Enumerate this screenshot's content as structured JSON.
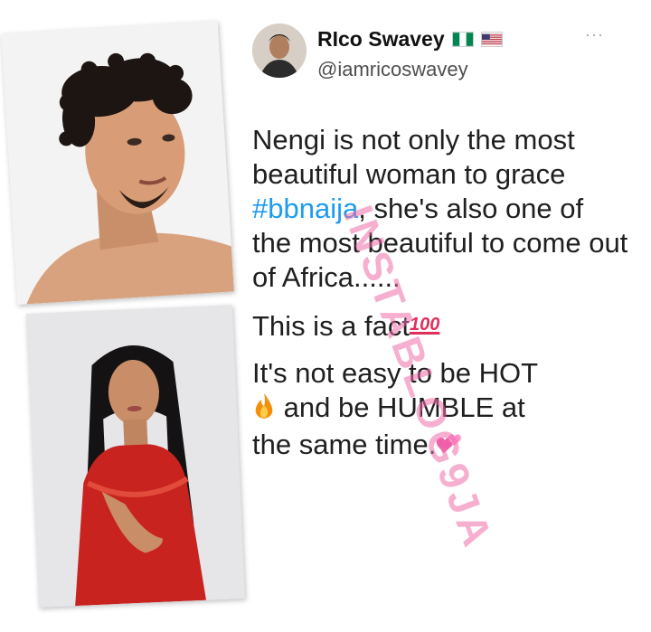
{
  "tweet": {
    "display_name": "RIco Swavey",
    "handle": "@iamricoswavey",
    "more_label": "···",
    "paragraph1": {
      "before": "Nengi is not only the most beautiful woman to grace ",
      "hashtag": "#bbnaija",
      "after": ", she's also one of the most beautiful to come out of Africa......"
    },
    "paragraph2": "This is a fact",
    "hundred_emoji": "100",
    "paragraph3": {
      "line1": "It's not easy to be HOT",
      "after_fire": "and be HUMBLE  at",
      "line3": "the same time."
    },
    "colors": {
      "hashtag": "#1d9bf0",
      "watermark": "#f06eaa"
    },
    "icons": [
      "nigeria-flag-icon",
      "usa-flag-icon",
      "fire-icon",
      "hundred-points-icon",
      "two-hearts-icon"
    ]
  },
  "watermark": "INSTABLOG9JA"
}
